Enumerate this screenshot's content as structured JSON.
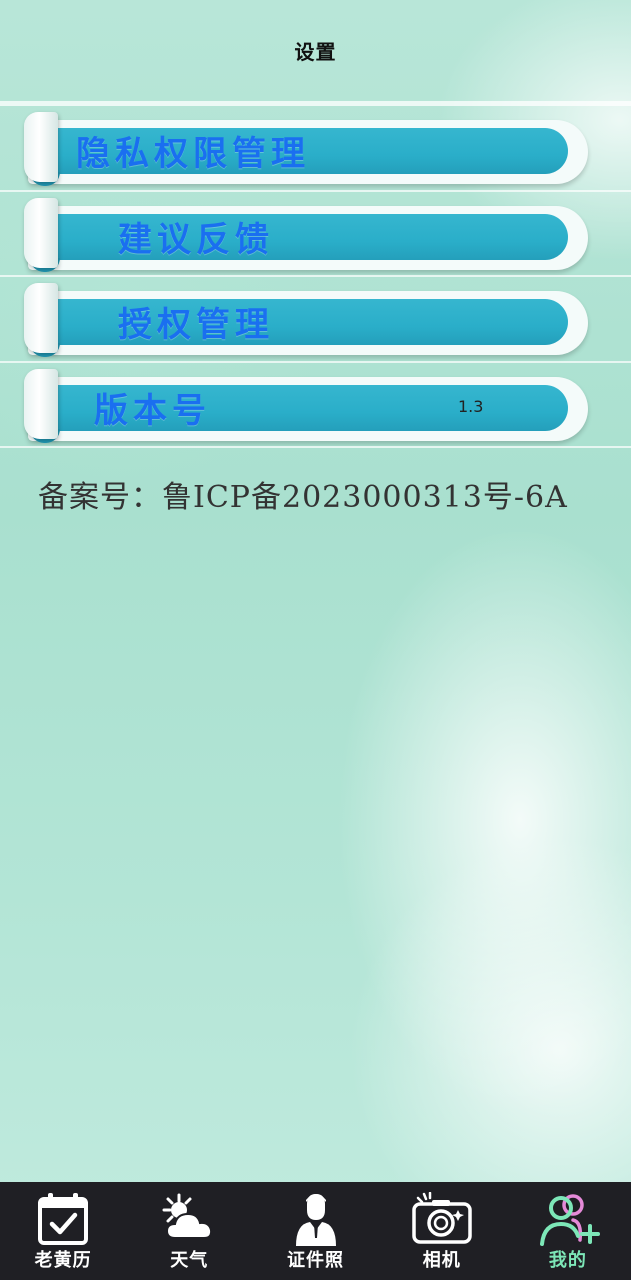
{
  "header": {
    "title": "设置"
  },
  "menu": {
    "items": [
      {
        "label": "隐私权限管理",
        "value": ""
      },
      {
        "label": "建议反馈",
        "value": ""
      },
      {
        "label": "授权管理",
        "value": ""
      },
      {
        "label": "版本号",
        "value": "1.3"
      }
    ]
  },
  "footer_info": {
    "icp": "备案号：鲁ICP备2023000313号-6A"
  },
  "tabbar": {
    "active_index": 4,
    "active_color": "#7de7b8",
    "background": "#1f1f24",
    "tabs": [
      {
        "label": "老黄历",
        "icon": "calendar-check-icon"
      },
      {
        "label": "天气",
        "icon": "weather-sun-cloud-icon"
      },
      {
        "label": "证件照",
        "icon": "id-photo-person-icon"
      },
      {
        "label": "相机",
        "icon": "camera-icon"
      },
      {
        "label": "我的",
        "icon": "users-add-icon"
      }
    ]
  },
  "colors": {
    "ribbon": "#2aaec9",
    "ribbon_text": "#1a6ff0",
    "background": "#b3e5d6"
  }
}
